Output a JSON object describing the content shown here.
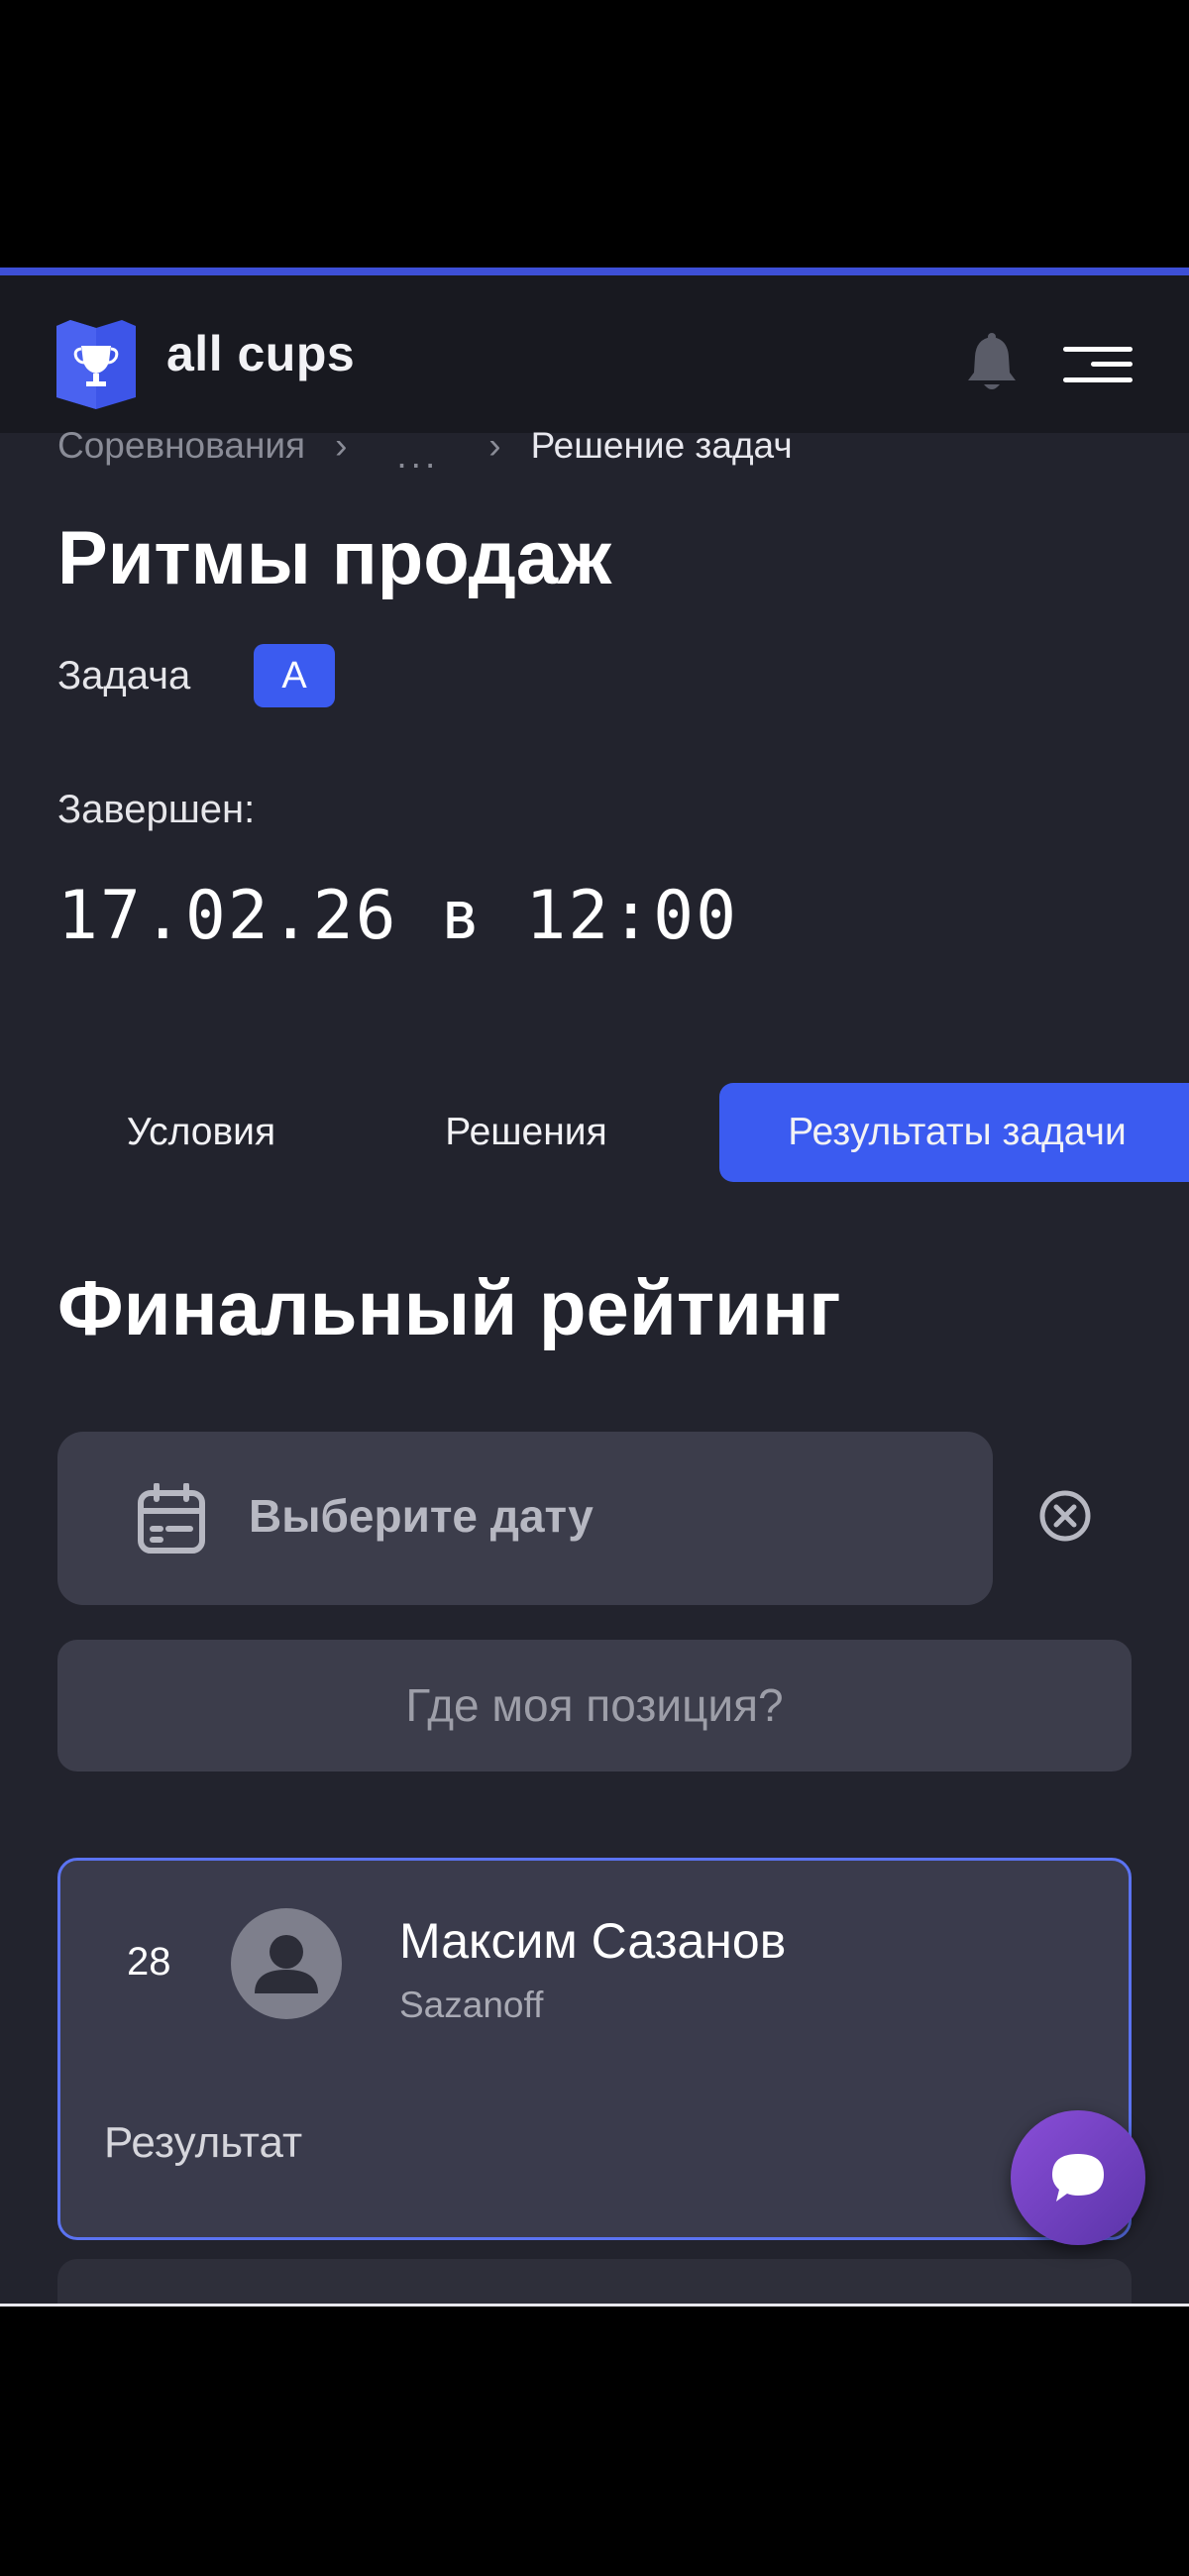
{
  "header": {
    "brand": "all cups",
    "brand_color": "#3d4fd6"
  },
  "breadcrumb": {
    "items": [
      "Соревнования",
      "...",
      "Решение задач"
    ]
  },
  "page": {
    "title": "Ритмы продаж",
    "task_label": "Задача",
    "task_badge": "A",
    "ended_label": "Завершен:",
    "ended_date": "17.02.26 в 12:00"
  },
  "tabs": [
    {
      "label": "Условия",
      "active": false
    },
    {
      "label": "Решения",
      "active": false
    },
    {
      "label": "Результаты задачи",
      "active": true
    }
  ],
  "rating": {
    "title": "Финальный рейтинг",
    "date_placeholder": "Выберите дату",
    "my_position_label": "Где моя позиция?"
  },
  "results": [
    {
      "rank": "28",
      "name": "Максим Сазанов",
      "login": "Sazanoff",
      "result_label": "Результат"
    }
  ],
  "colors": {
    "accent": "#3b5bf0",
    "background": "#22232d",
    "card": "#3a3b4c",
    "chat": "#8a4ed8"
  },
  "icons": [
    "trophy-logo-icon",
    "bell-icon",
    "menu-icon",
    "calendar-icon",
    "clear-icon",
    "user-avatar-icon",
    "chat-icon"
  ]
}
